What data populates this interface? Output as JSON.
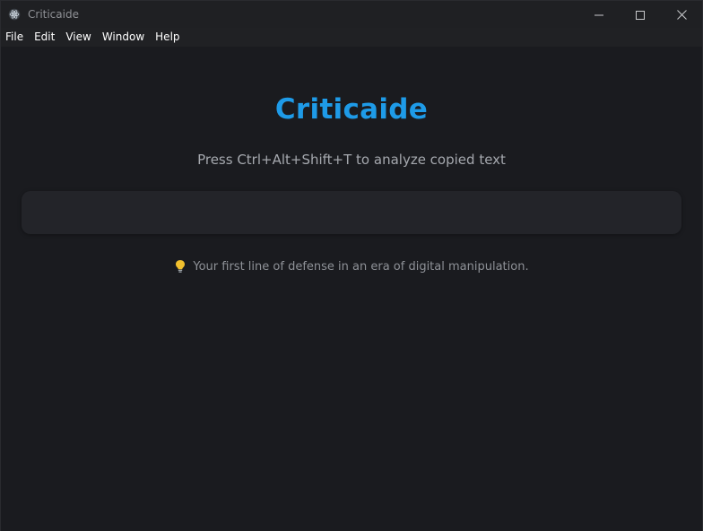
{
  "window": {
    "title": "Criticaide",
    "icon": "electron-atom-icon",
    "controls": [
      "minimize-icon",
      "maximize-icon",
      "close-icon"
    ]
  },
  "menu": {
    "items": [
      {
        "label": "File"
      },
      {
        "label": "Edit"
      },
      {
        "label": "View"
      },
      {
        "label": "Window"
      },
      {
        "label": "Help"
      }
    ]
  },
  "main": {
    "title": "Criticaide",
    "subtitle": "Press Ctrl+Alt+Shift+T to analyze copied text",
    "result_text": "",
    "tagline_icon": "lightbulb-icon",
    "tagline": "Your first line of defense in an era of digital manipulation."
  },
  "colors": {
    "accent": "#1e9be8",
    "background": "#1a1b1f",
    "panel": "#232429",
    "bulb": "#f2c12e"
  }
}
